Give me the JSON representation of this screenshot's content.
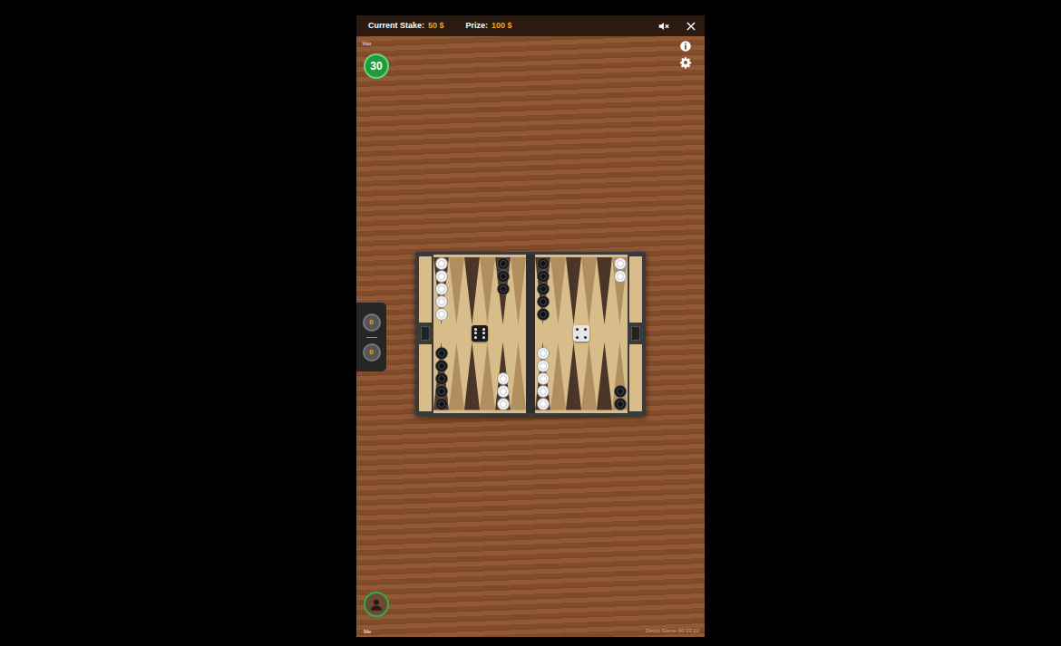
{
  "header": {
    "stake_label": "Current Stake:",
    "stake_value": "50 $",
    "prize_label": "Prize:",
    "prize_value": "100 $"
  },
  "sound": {
    "muted": true
  },
  "opponent": {
    "label": "You",
    "timer": "30"
  },
  "player": {
    "label": "Me"
  },
  "scores": [
    "0",
    "0"
  ],
  "board": {
    "top_points": [
      {
        "checkers": 5,
        "side": "white"
      },
      {
        "checkers": 0,
        "side": "none"
      },
      {
        "checkers": 0,
        "side": "none"
      },
      {
        "checkers": 0,
        "side": "none"
      },
      {
        "checkers": 3,
        "side": "black"
      },
      {
        "checkers": 0,
        "side": "none"
      },
      {
        "checkers": 5,
        "side": "black"
      },
      {
        "checkers": 0,
        "side": "none"
      },
      {
        "checkers": 0,
        "side": "none"
      },
      {
        "checkers": 0,
        "side": "none"
      },
      {
        "checkers": 0,
        "side": "none"
      },
      {
        "checkers": 2,
        "side": "white"
      }
    ],
    "bottom_points": [
      {
        "checkers": 5,
        "side": "black"
      },
      {
        "checkers": 0,
        "side": "none"
      },
      {
        "checkers": 0,
        "side": "none"
      },
      {
        "checkers": 0,
        "side": "none"
      },
      {
        "checkers": 3,
        "side": "white"
      },
      {
        "checkers": 0,
        "side": "none"
      },
      {
        "checkers": 5,
        "side": "white"
      },
      {
        "checkers": 0,
        "side": "none"
      },
      {
        "checkers": 0,
        "side": "none"
      },
      {
        "checkers": 0,
        "side": "none"
      },
      {
        "checkers": 0,
        "side": "none"
      },
      {
        "checkers": 2,
        "side": "black"
      }
    ],
    "dice": [
      {
        "value": 6,
        "color": "#1a1a1a"
      },
      {
        "value": 4,
        "color": "#e6e6e6"
      }
    ]
  },
  "footer": {
    "status": "Demo Game 00:33:22"
  }
}
